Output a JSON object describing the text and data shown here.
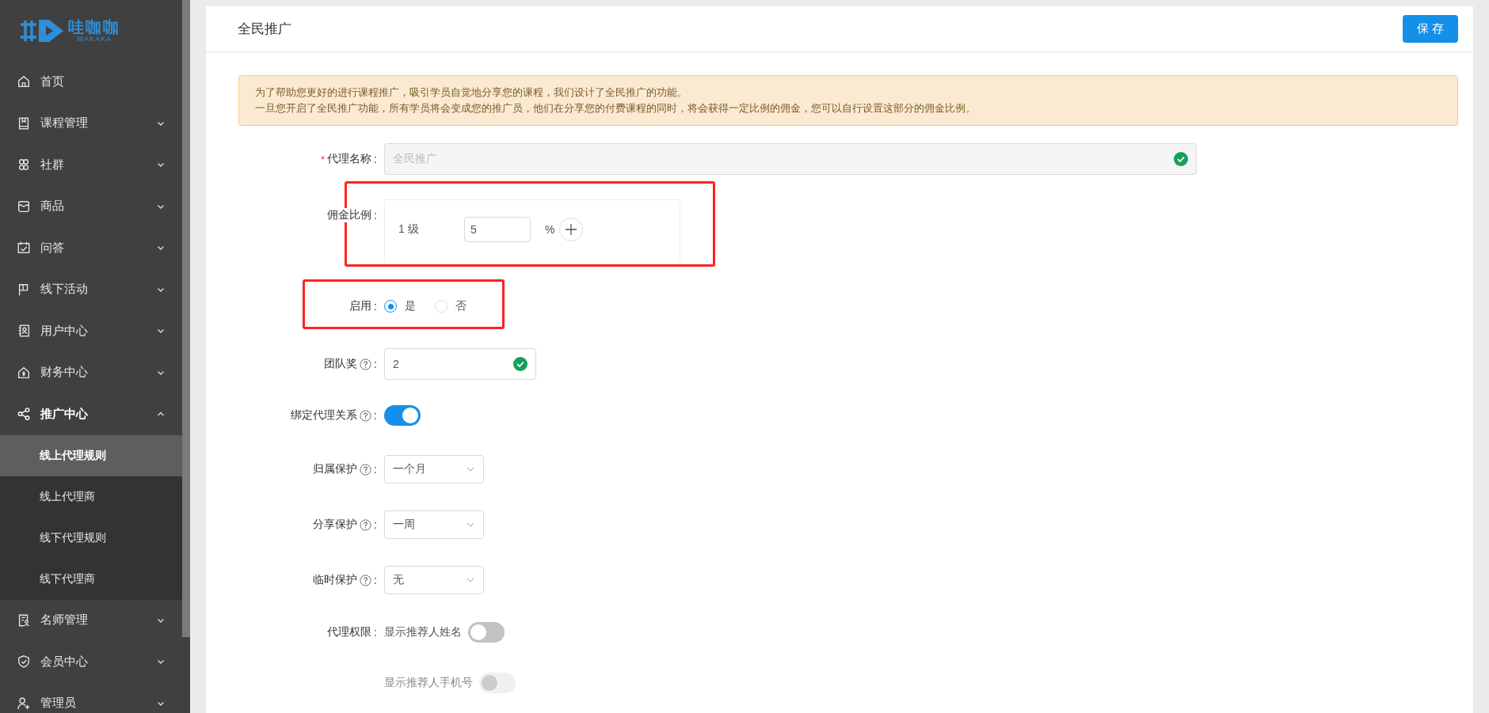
{
  "sidebar": {
    "logo": {
      "text": "哇咖咖",
      "subtext": "WAKAKA"
    },
    "items": [
      {
        "label": "首页",
        "kind": "link",
        "expanded": false
      },
      {
        "label": "课程管理",
        "kind": "group",
        "expanded": false
      },
      {
        "label": "社群",
        "kind": "group",
        "expanded": false
      },
      {
        "label": "商品",
        "kind": "group",
        "expanded": false
      },
      {
        "label": "问答",
        "kind": "group",
        "expanded": false
      },
      {
        "label": "线下活动",
        "kind": "group",
        "expanded": false
      },
      {
        "label": "用户中心",
        "kind": "group",
        "expanded": false
      },
      {
        "label": "财务中心",
        "kind": "group",
        "expanded": false
      },
      {
        "label": "推广中心",
        "kind": "group",
        "expanded": true,
        "children": [
          {
            "label": "线上代理规则",
            "selected": true
          },
          {
            "label": "线上代理商",
            "selected": false
          },
          {
            "label": "线下代理规则",
            "selected": false
          },
          {
            "label": "线下代理商",
            "selected": false
          }
        ]
      },
      {
        "label": "名师管理",
        "kind": "group",
        "expanded": false
      },
      {
        "label": "会员中心",
        "kind": "group",
        "expanded": false
      },
      {
        "label": "管理员",
        "kind": "group",
        "expanded": false
      }
    ]
  },
  "page": {
    "title": "全民推广",
    "save_button": "保 存"
  },
  "notice": {
    "lines": [
      "为了帮助您更好的进行课程推广，吸引学员自觉地分享您的课程，我们设计了全民推广的功能。",
      "一旦您开启了全民推广功能，所有学员将会变成您的推广员，他们在分享您的付费课程的同时，将会获得一定比例的佣金，您可以自行设置这部分的佣金比例。"
    ]
  },
  "form": [
    {
      "kind": "text",
      "required_mark": "*",
      "label": "代理名称",
      "colon": ":",
      "value": "全民推广",
      "disabled": true,
      "valid": true
    },
    {
      "kind": "commission",
      "label": "佣金比例",
      "colon": ":",
      "annotated": true,
      "levels": [
        {
          "name": "1 级",
          "value": "5",
          "unit": "%"
        }
      ]
    },
    {
      "kind": "radio",
      "label": "启用",
      "colon": ":",
      "annotated": true,
      "options": [
        {
          "label": "是",
          "selected": true
        },
        {
          "label": "否",
          "selected": false
        }
      ]
    },
    {
      "kind": "text",
      "label": "团队奖",
      "colon": ":",
      "help": true,
      "value": "2",
      "disabled": false,
      "valid": true
    },
    {
      "kind": "switch",
      "label": "绑定代理关系",
      "colon": ":",
      "help": true,
      "on": true,
      "disabled": false
    },
    {
      "kind": "select",
      "label": "归属保护",
      "colon": ":",
      "help": true,
      "value": "一个月"
    },
    {
      "kind": "select",
      "label": "分享保护",
      "colon": ":",
      "help": true,
      "value": "一周"
    },
    {
      "kind": "select",
      "label": "临时保护",
      "colon": ":",
      "help": true,
      "value": "无"
    },
    {
      "kind": "switch",
      "label": "代理权限",
      "colon": ":",
      "text": "显示推荐人姓名",
      "on": false,
      "disabled": false
    },
    {
      "kind": "switch",
      "text": "显示推荐人手机号",
      "on": false,
      "disabled": true
    }
  ]
}
